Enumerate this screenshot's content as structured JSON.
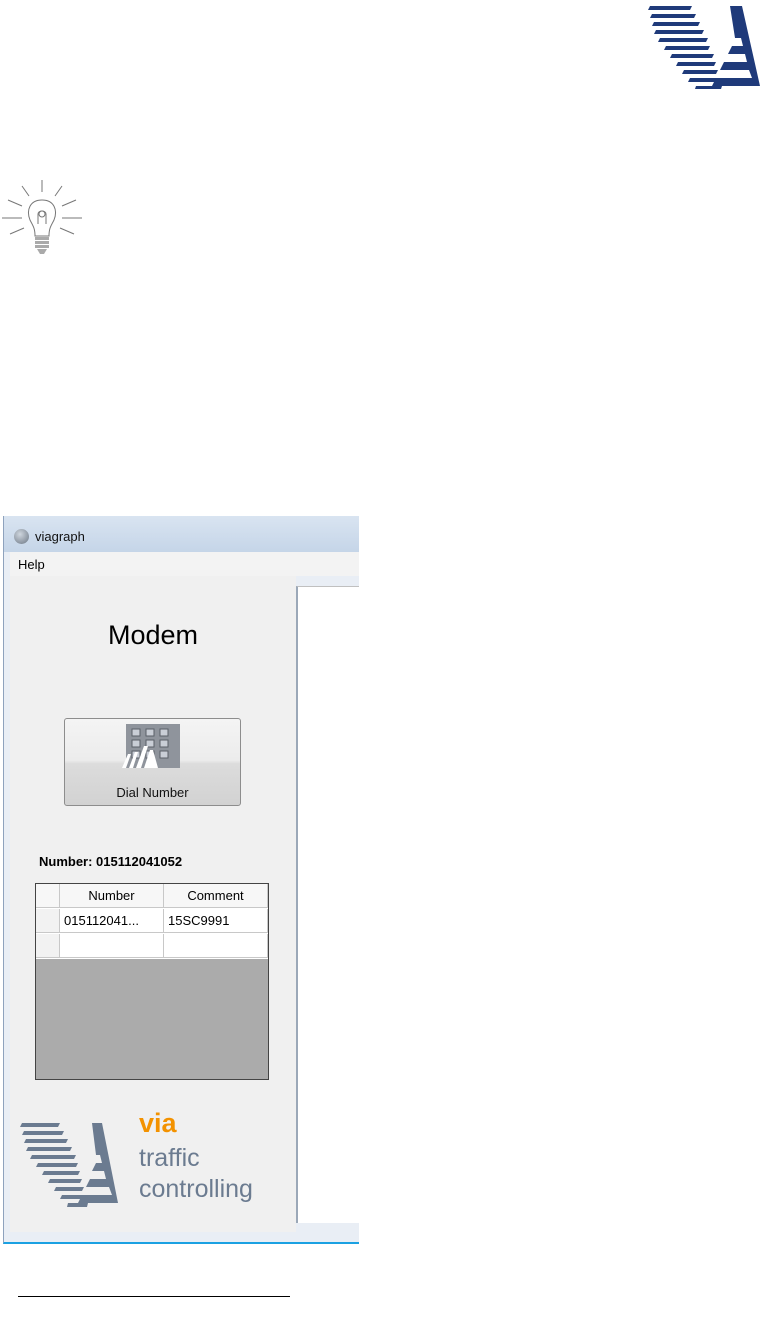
{
  "icons": {
    "header_logo": "via-logo",
    "tip": "lightbulb-icon",
    "app": "app-globe-icon",
    "dial": "keypad-icon"
  },
  "colors": {
    "logo_navy": "#1f3a7a",
    "brand_orange": "#f39200",
    "brand_gray": "#6b7b90",
    "taskbar_blue": "#1ba1e2"
  },
  "app": {
    "title": "viagraph",
    "menu": [
      "Help"
    ],
    "panel_title": "Modem",
    "dial_button_label": "Dial Number",
    "number_line": "Number: 015112041052",
    "grid": {
      "columns": [
        "Number",
        "Comment"
      ],
      "rows": [
        [
          "015112041...",
          "15SC9991"
        ],
        [
          "",
          ""
        ]
      ]
    },
    "brand": {
      "word": "via",
      "line1": "traffic",
      "line2": "controlling"
    }
  }
}
